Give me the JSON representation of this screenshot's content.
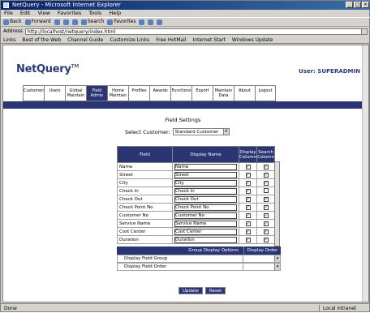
{
  "window": {
    "title": "NetQuery - Microsoft Internet Explorer"
  },
  "menu": [
    "File",
    "Edit",
    "View",
    "Favorites",
    "Tools",
    "Help"
  ],
  "toolbar": [
    "Back",
    "Forward",
    "Stop",
    "Refresh",
    "Home",
    "Search",
    "Favorites",
    "History",
    "Mail",
    "Print",
    "Edit"
  ],
  "address": {
    "label": "Address",
    "value": "http://localhost/netquery/index.html",
    "go": "Go"
  },
  "links": {
    "label": "Links",
    "items": [
      "Best of the Web",
      "Channel Guide",
      "Customize Links",
      "Free HotMail",
      "Internet Start",
      "Windows Update"
    ]
  },
  "header": {
    "logo": "NetQuery",
    "tm": "TM",
    "user": "User: SUPERADMIN"
  },
  "nav": [
    "Customers",
    "Users",
    "Global Maintain",
    "Field Admin",
    "Home Maintain",
    "Profiles",
    "Awards",
    "Functions",
    "Export",
    "Maintain Data",
    "About",
    "Logout"
  ],
  "nav_active_index": 3,
  "page": {
    "heading": "Field Settings",
    "customer_label": "Select Customer:",
    "customer_value": "Standard Customer"
  },
  "grid": {
    "columns": [
      "Field",
      "Display Name",
      "Display Column",
      "Search Column"
    ],
    "rows": [
      {
        "field": "Name",
        "display": "Name",
        "disp": true,
        "search": true
      },
      {
        "field": "Street",
        "display": "Street",
        "disp": true,
        "search": true
      },
      {
        "field": "City",
        "display": "City",
        "disp": true,
        "search": true
      },
      {
        "field": "Check In",
        "display": "Check In",
        "disp": true,
        "search": false
      },
      {
        "field": "Check Out",
        "display": "Check Out",
        "disp": true,
        "search": true
      },
      {
        "field": "Check Point No",
        "display": "Check Point No",
        "disp": true,
        "search": true
      },
      {
        "field": "Customer No",
        "display": "Customer No",
        "disp": true,
        "search": true
      },
      {
        "field": "Service Name",
        "display": "Service Name",
        "disp": true,
        "search": true
      },
      {
        "field": "Cost Center",
        "display": "Cost Center",
        "disp": true,
        "search": true
      },
      {
        "field": "Duration",
        "display": "Duration",
        "disp": true,
        "search": true
      }
    ]
  },
  "group": {
    "header_a": "Group Display Options",
    "header_b": "Display Order",
    "rows": [
      {
        "label": "Display Field Group",
        "value": ""
      },
      {
        "label": "Display Field Order",
        "value": ""
      }
    ]
  },
  "buttons": {
    "update": "Update",
    "reset": "Reset"
  },
  "status": {
    "left": "Done",
    "zone": "Local intranet"
  }
}
